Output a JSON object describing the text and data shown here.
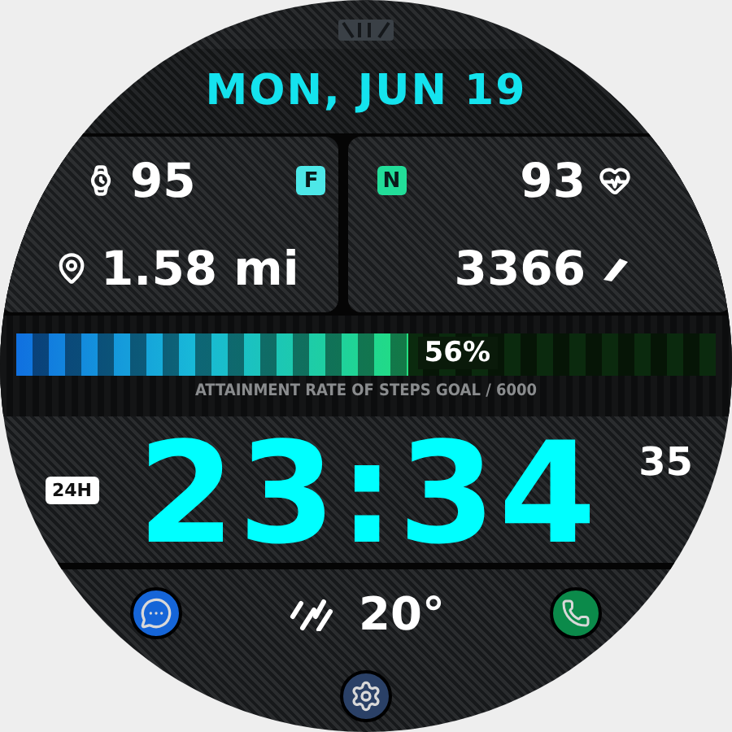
{
  "date": "MON, JUN 19",
  "left_panel": {
    "watch_battery": "95",
    "badge": {
      "label": "F",
      "color": "#4de8e8"
    },
    "distance": "1.58 mi"
  },
  "right_panel": {
    "badge": {
      "label": "N",
      "color": "#22dd99"
    },
    "heart_rate": "93",
    "steps": "3366"
  },
  "steps_goal": {
    "level": 0.56,
    "percent": "56%",
    "caption": "ATTAINMENT RATE OF STEPS GOAL / 6000"
  },
  "clock": {
    "format": "24H",
    "time": "23:34",
    "seconds": "35"
  },
  "weather": {
    "temperature": "20°"
  }
}
